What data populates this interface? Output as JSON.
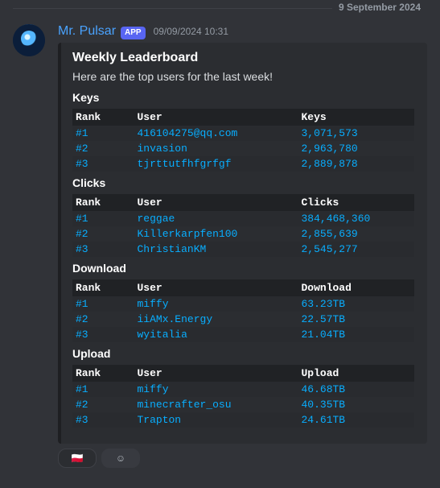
{
  "divider_date": "9 September 2024",
  "author": {
    "name": "Mr. Pulsar",
    "badge": "APP",
    "timestamp": "09/09/2024 10:31"
  },
  "embed": {
    "title": "Weekly Leaderboard",
    "description": "Here are the top users for the last week!",
    "sections": [
      {
        "title": "Keys",
        "columns": [
          "Rank",
          "User",
          "Keys"
        ],
        "rows": [
          [
            "#1",
            "416104275@qq.com",
            "3,071,573"
          ],
          [
            "#2",
            "invasion",
            "2,963,780"
          ],
          [
            "#3",
            "tjrttutfhfgrfgf",
            "2,889,878"
          ]
        ]
      },
      {
        "title": "Clicks",
        "columns": [
          "Rank",
          "User",
          "Clicks"
        ],
        "rows": [
          [
            "#1",
            "reggae",
            "384,468,360"
          ],
          [
            "#2",
            "Killerkarpfen100",
            "2,855,639"
          ],
          [
            "#3",
            "ChristianKM",
            "2,545,277"
          ]
        ]
      },
      {
        "title": "Download",
        "columns": [
          "Rank",
          "User",
          "Download"
        ],
        "rows": [
          [
            "#1",
            "miffy",
            "63.23TB"
          ],
          [
            "#2",
            "iiAMx.Energy",
            "22.57TB"
          ],
          [
            "#3",
            "wyitalia",
            "21.04TB"
          ]
        ]
      },
      {
        "title": "Upload",
        "columns": [
          "Rank",
          "User",
          "Upload"
        ],
        "rows": [
          [
            "#1",
            "miffy",
            "46.68TB"
          ],
          [
            "#2",
            "minecrafter_osu",
            "40.35TB"
          ],
          [
            "#3",
            "Trapton",
            "24.61TB"
          ]
        ]
      }
    ]
  },
  "col_widths_default": [
    "18%",
    "48%",
    "34%"
  ],
  "col_widths_dl": [
    "18%",
    "48%",
    "34%"
  ],
  "reactions": {
    "first_emoji": "🇵🇱",
    "add_icon": "☺"
  }
}
